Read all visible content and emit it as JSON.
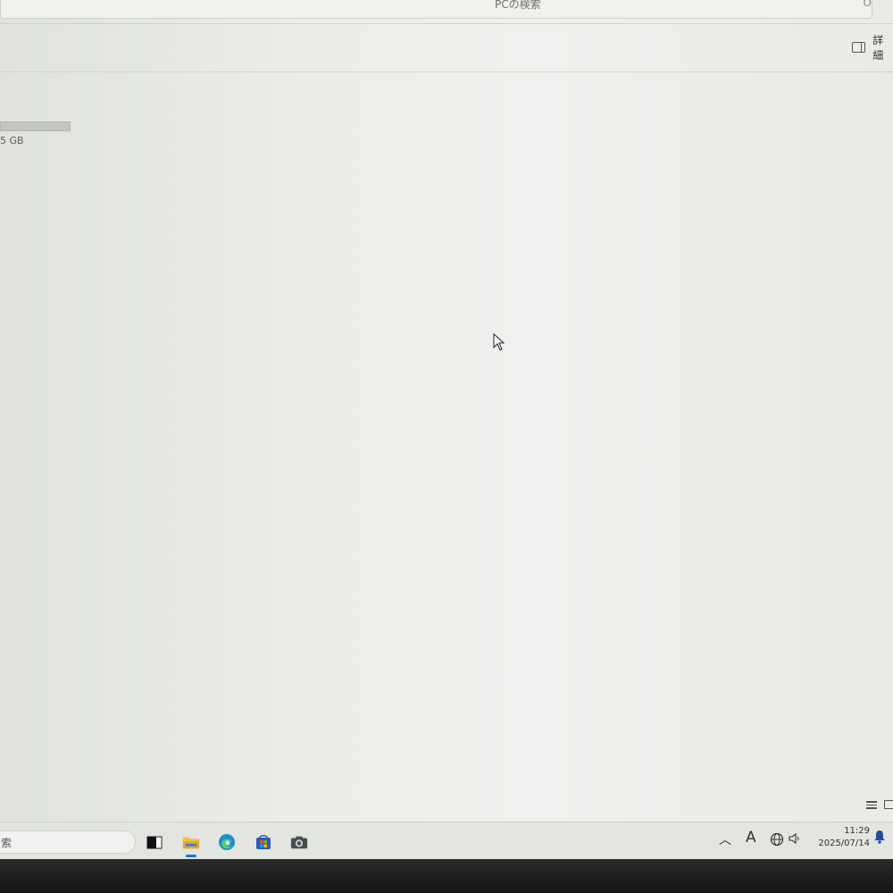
{
  "search": {
    "placeholder": "PCの検索"
  },
  "toolbar": {
    "details_label": "詳細"
  },
  "drive": {
    "size_text": "5 GB"
  },
  "taskbar": {
    "search_text": "索",
    "clock_time": "11:29",
    "clock_date": "2025/07/14",
    "ime_label": "A",
    "icons": [
      "task-view-icon",
      "file-explorer-icon",
      "edge-icon",
      "store-icon",
      "camera-icon"
    ]
  },
  "colors": {
    "accent": "#2a6fd6",
    "edge": "#1f8fd1",
    "store": "#2d5bb9",
    "explorer": "#f2c13b"
  }
}
